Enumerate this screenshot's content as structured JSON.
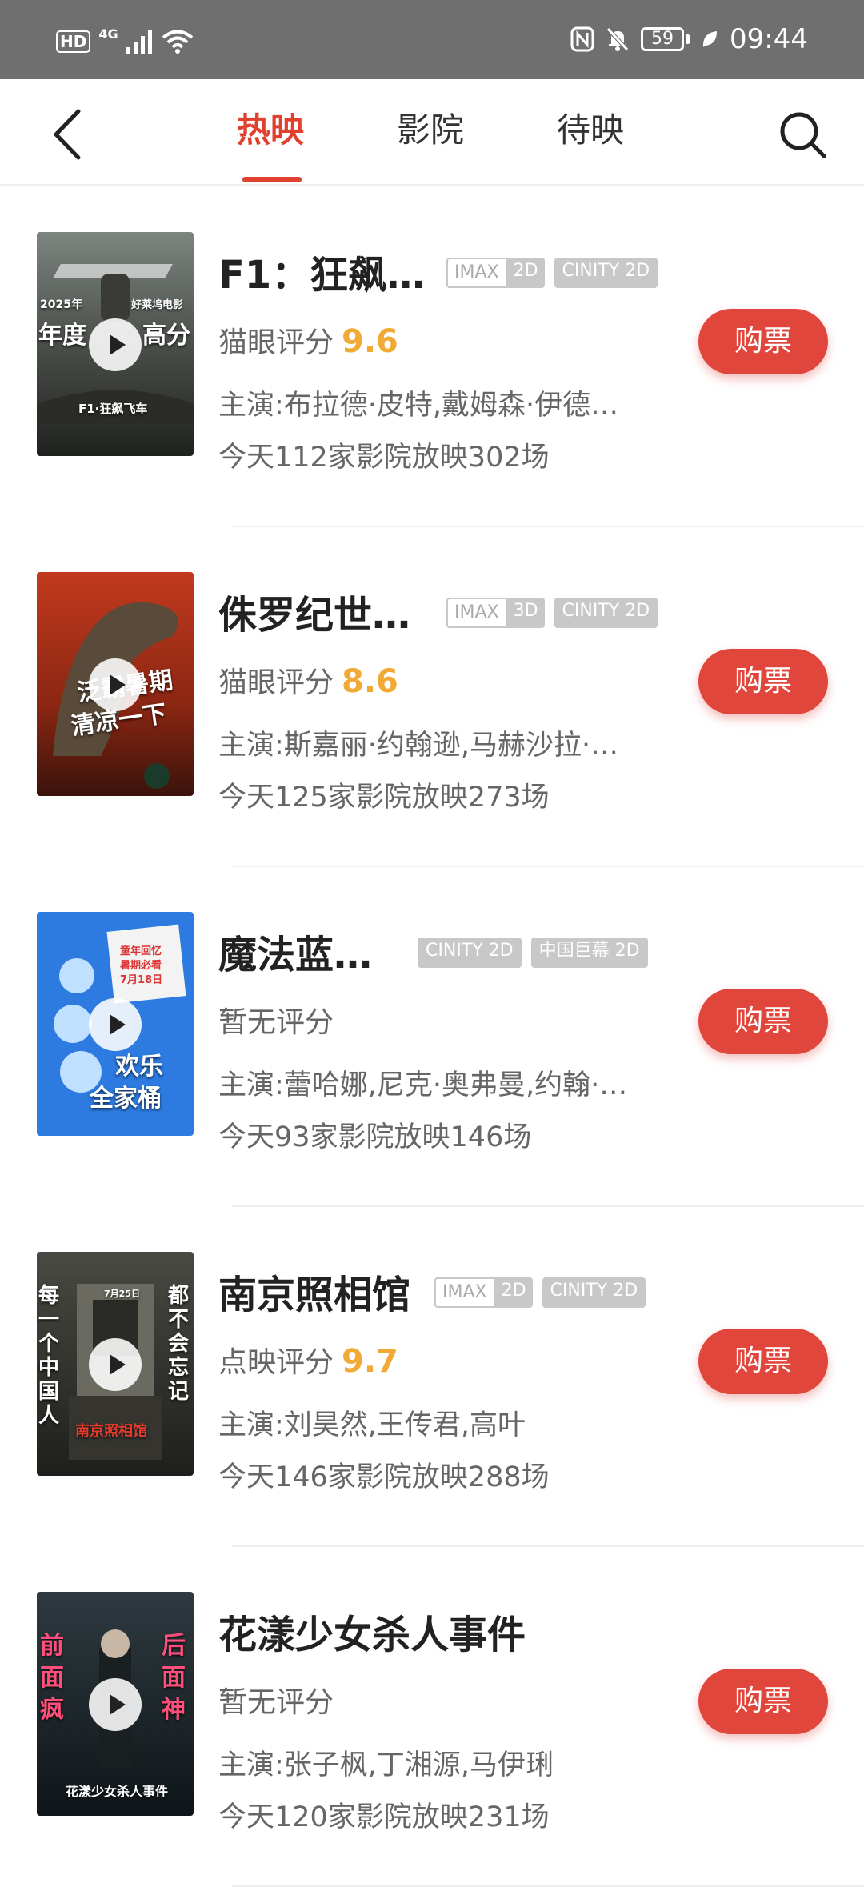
{
  "status_bar": {
    "hd": "HD",
    "signal_label": "4G",
    "battery": "59",
    "time": "09:44"
  },
  "nav": {
    "tabs": [
      {
        "label": "热映",
        "active": true
      },
      {
        "label": "影院",
        "active": false
      },
      {
        "label": "待映",
        "active": false
      }
    ]
  },
  "buy_label": "购票",
  "movies": [
    {
      "title": "F1：狂飙…",
      "tags": [
        {
          "text": "IMAX",
          "suffix": "2D"
        },
        {
          "text": "CINITY 2D"
        }
      ],
      "score_label": "猫眼评分",
      "score": "9.6",
      "cast": "主演:布拉德·皮特,戴姆森·伊德…",
      "shows": "今天112家影院放映302场",
      "poster_text": [
        "2025年",
        "好莱坞电影",
        "年度",
        "高分",
        "F1·狂飙飞车"
      ]
    },
    {
      "title": "侏罗纪世…",
      "tags": [
        {
          "text": "IMAX",
          "suffix": "3D"
        },
        {
          "text": "CINITY 2D"
        }
      ],
      "score_label": "猫眼评分",
      "score": "8.6",
      "cast": "主演:斯嘉丽·约翰逊,马赫沙拉·…",
      "shows": "今天125家影院放映273场",
      "poster_text": [
        "泛霸暑期",
        "清凉一下"
      ]
    },
    {
      "title": "魔法蓝…",
      "tags": [
        {
          "text": "CINITY 2D"
        },
        {
          "text": "中国巨幕 2D"
        }
      ],
      "score_label": "暂无评分",
      "score": "",
      "cast": "主演:蕾哈娜,尼克·奥弗曼,约翰·…",
      "shows": "今天93家影院放映146场",
      "poster_text": [
        "童年回忆",
        "暑期必看",
        "7月18日",
        "欢乐",
        "全家桶"
      ]
    },
    {
      "title": "南京照相馆",
      "tags": [
        {
          "text": "IMAX",
          "suffix": "2D"
        },
        {
          "text": "CINITY 2D"
        }
      ],
      "score_label": "点映评分",
      "score": "9.7",
      "cast": "主演:刘昊然,王传君,高叶",
      "shows": "今天146家影院放映288场",
      "poster_text": [
        "每一个中国人",
        "都不会忘记",
        "7月25日",
        "南京照相馆"
      ]
    },
    {
      "title": "花漾少女杀人事件",
      "tags": [],
      "score_label": "暂无评分",
      "score": "",
      "cast": "主演:张子枫,丁湘源,马伊琍",
      "shows": "今天120家影院放映231场",
      "poster_text": [
        "前面疯",
        "后面神",
        "花漾少女杀人事件"
      ]
    }
  ],
  "colors": {
    "accent": "#e0402e",
    "score": "#f0aa35",
    "buy_button": "#e0463c",
    "tag": "#c8c8c8"
  }
}
